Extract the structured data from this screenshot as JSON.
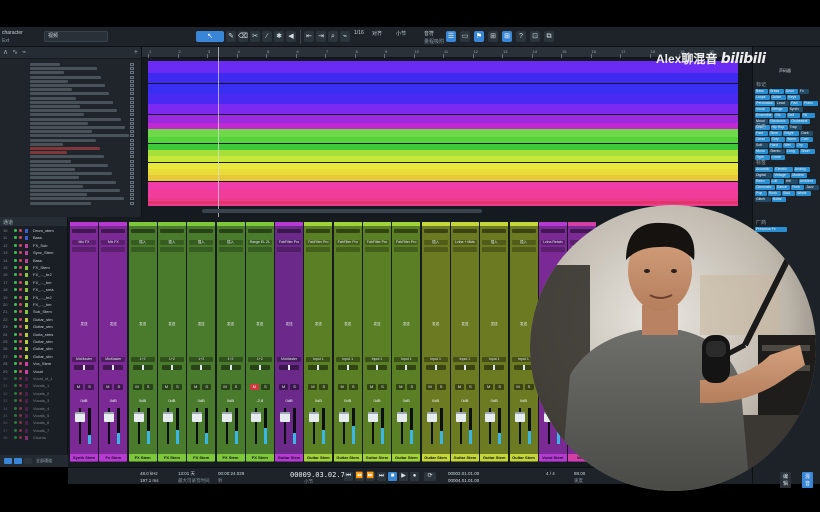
{
  "toolbar": {
    "project_label": "character",
    "project_sub": "Ext",
    "dropdown_label": "视频",
    "key_label": "1/16",
    "quantize_label": "对齐",
    "timebase_label": "小节",
    "snap_label": "音符",
    "snap_value": "量程吸附",
    "tools": [
      "↖",
      "✎",
      "⌫",
      "✂",
      "∕",
      "✱",
      "◀",
      "⌁"
    ],
    "right_buttons": [
      "☰",
      "▭",
      "⚑",
      "⊞",
      "?",
      "⊡",
      "⧉"
    ]
  },
  "watermark": {
    "name": "Alex聊混音",
    "brand": "bilibili",
    "sub": "声码器"
  },
  "ruler": {
    "marks": [
      "1",
      "2",
      "3",
      "4",
      "5",
      "6",
      "7",
      "8",
      "9",
      "10",
      "11",
      "12",
      "13",
      "14",
      "15",
      "16",
      "17",
      "18",
      "19",
      "20"
    ]
  },
  "tagpanel": {
    "heading_1": "标记",
    "tags_1": [
      "Bass",
      "Brass",
      "Drum",
      "Fx",
      "Loops",
      "Guitar",
      "Keys",
      "Percussion",
      "Lead",
      "Pad",
      "Piano",
      "Vocal",
      "Strings",
      "Synth",
      "Ensemble",
      "Sfx",
      "Bell",
      "Fill",
      "Mood",
      "Electronic",
      "Orchestral",
      "Chill",
      "Hip Hop",
      "Trap"
    ],
    "heading_2": "风格",
    "tags_2": [
      "Fast",
      "Slow",
      "Bright",
      "Dark",
      "Clean",
      "Dirty",
      "Warm",
      "Cold",
      "Soft",
      "Hard",
      "Wet",
      "Dry",
      "Mono",
      "Stereo",
      "Long",
      "Short",
      "Tight",
      "Loose"
    ],
    "heading_3": "标签",
    "tags_3": [
      "Acoustic",
      "Electric",
      "Analog",
      "Digital",
      "Vintage",
      "Modern",
      "Retro",
      "Lofi",
      "Hifi",
      "Ambient",
      "Cinematic",
      "Dance",
      "Funk",
      "Jazz",
      "Pop",
      "Rock",
      "Soul",
      "World",
      "Glitch",
      "Noise"
    ],
    "heading_4": "厂商",
    "tag_vendor": "Presonus Fx"
  },
  "console_list": {
    "header": "通道",
    "rows": [
      {
        "num": "10",
        "name": "Drum_stem",
        "color": "#3a5bd9"
      },
      {
        "num": "11",
        "name": "Bass",
        "color": "#3a5bd9"
      },
      {
        "num": "12",
        "name": "FX_Sub",
        "color": "#c1429c"
      },
      {
        "num": "13",
        "name": "Sync_Stem",
        "color": "#c1429c"
      },
      {
        "num": "14",
        "name": "Bass",
        "color": "#c1429c"
      },
      {
        "num": "15",
        "name": "FX_Stem",
        "color": "#8ac43f"
      },
      {
        "num": "16",
        "name": "FX_..._br2",
        "color": "#8ac43f"
      },
      {
        "num": "17",
        "name": "FX_..._bm",
        "color": "#8ac43f"
      },
      {
        "num": "18",
        "name": "FX_..._sma",
        "color": "#8ac43f"
      },
      {
        "num": "19",
        "name": "FX_..._br2",
        "color": "#8ac43f"
      },
      {
        "num": "20",
        "name": "FX_..._bm",
        "color": "#8ac43f"
      },
      {
        "num": "21",
        "name": "Sub_Stem",
        "color": "#8ac43f"
      },
      {
        "num": "22",
        "name": "Guitar_stm",
        "color": "#b9c93a"
      },
      {
        "num": "23",
        "name": "Guitar_stm",
        "color": "#b9c93a"
      },
      {
        "num": "24",
        "name": "Guita_stms",
        "color": "#b9c93a"
      },
      {
        "num": "25",
        "name": "Guitar_stm",
        "color": "#b9c93a"
      },
      {
        "num": "26",
        "name": "Guitar_stm",
        "color": "#b9c93a"
      },
      {
        "num": "27",
        "name": "Guitar_stm",
        "color": "#b9c93a"
      },
      {
        "num": "28",
        "name": "Vox_Stem",
        "color": "#d43fa4"
      },
      {
        "num": "29",
        "name": "Vocal",
        "color": "#d43fa4"
      },
      {
        "num": "30",
        "name": "Vocal_st_1",
        "color": "#7a1f6a"
      },
      {
        "num": "31",
        "name": "Vocals_1",
        "color": "#7a1f6a"
      },
      {
        "num": "32",
        "name": "Vocals_2",
        "color": "#7a1f6a"
      },
      {
        "num": "33",
        "name": "Vocals_3",
        "color": "#7a1f6a"
      },
      {
        "num": "34",
        "name": "Vocals_4",
        "color": "#7a1f6a"
      },
      {
        "num": "35",
        "name": "Vocals_5",
        "color": "#7a1f6a"
      },
      {
        "num": "36",
        "name": "Vocals_6",
        "color": "#7a1f6a"
      },
      {
        "num": "37",
        "name": "Vocals_7",
        "color": "#7a1f6a"
      },
      {
        "num": "38",
        "name": "Chorus",
        "color": "#d43fa4"
      }
    ],
    "footer": "全部通道"
  },
  "arrangement": {
    "clip_colors": [
      "#6a2bf5",
      "#3f2bf0",
      "#3a2ef2",
      "#4a2af2",
      "#7c2af0",
      "#9a2bdf",
      "#c12ad0",
      "#6fd94a",
      "#56d43c",
      "#3ec83a",
      "#a8e03a",
      "#c6e83a",
      "#e8e83a",
      "#e8dc3a",
      "#e8c83a",
      "#f03ca8",
      "#f23c9a",
      "#ef3a92"
    ]
  },
  "mixer": {
    "strips": [
      {
        "name": "Synth Stem",
        "color": "#7b2a95",
        "name_color": "#b63ad2",
        "insert": "Mix FX",
        "send": "发送",
        "route": "MixMaster",
        "vol": "0dB",
        "level": 0.25
      },
      {
        "name": "Fx Stem",
        "color": "#7b2a95",
        "name_color": "#b63ad2",
        "insert": "Mix FX",
        "send": "发送",
        "route": "MixMaster",
        "vol": "0dB",
        "level": 0.3
      },
      {
        "name": "FX Stem",
        "color": "#4a7b2c",
        "name_color": "#7ec73a",
        "insert": "插入",
        "send": "发送",
        "route": "1+2",
        "vol": "0dB",
        "level": 0.35
      },
      {
        "name": "FX Stem",
        "color": "#4a7b2c",
        "name_color": "#7ec73a",
        "insert": "插入",
        "send": "发送",
        "route": "1+2",
        "vol": "0dB",
        "level": 0.4
      },
      {
        "name": "FX Stem",
        "color": "#4a7b2c",
        "name_color": "#7ec73a",
        "insert": "插入",
        "send": "发送",
        "route": "1+2",
        "vol": "0dB",
        "level": 0.3
      },
      {
        "name": "FX Stem",
        "color": "#4a7b2c",
        "name_color": "#7ec73a",
        "insert": "插入",
        "send": "发送",
        "route": "1+2",
        "vol": "0dB",
        "level": 0.35
      },
      {
        "name": "FX Stem",
        "color": "#4a7b2c",
        "name_color": "#7ec73a",
        "insert": "Range EL 2L",
        "send": "发送",
        "route": "1+2",
        "vol": "-2.8",
        "level": 0.45
      },
      {
        "name": "Guitar Stem",
        "color": "#6b2a8a",
        "name_color": "#b63ad2",
        "insert": "FabFilter Pro",
        "send": "发送",
        "route": "MixMaster",
        "vol": "0dB",
        "level": 0.3
      },
      {
        "name": "Guitar Stem",
        "color": "#5a7f24",
        "name_color": "#a2d23a",
        "insert": "FabFilter Pro",
        "send": "发送",
        "route": "Input 1",
        "vol": "0dB",
        "level": 0.4
      },
      {
        "name": "Guitar Stem",
        "color": "#5a7f24",
        "name_color": "#a2d23a",
        "insert": "FabFilter Pro",
        "send": "发送",
        "route": "Input 1",
        "vol": "0dB",
        "level": 0.5
      },
      {
        "name": "Guitar Stem",
        "color": "#5a7f24",
        "name_color": "#a2d23a",
        "insert": "FabFilter Pro",
        "send": "发送",
        "route": "Input 1",
        "vol": "0dB",
        "level": 0.45
      },
      {
        "name": "Guitar Stem",
        "color": "#5a7f24",
        "name_color": "#a2d23a",
        "insert": "FabFilter Pro",
        "send": "发送",
        "route": "Input 1",
        "vol": "0dB",
        "level": 0.4
      },
      {
        "name": "Guitar Stem",
        "color": "#6c7a22",
        "name_color": "#c4d63a",
        "insert": "插入",
        "send": "发送",
        "route": "Input 1",
        "vol": "0dB",
        "level": 0.35
      },
      {
        "name": "Guitar Stem",
        "color": "#6c7a22",
        "name_color": "#c4d63a",
        "insert": "Lvlna + Mkts",
        "send": "发送",
        "route": "Input 1",
        "vol": "0dB",
        "level": 0.4
      },
      {
        "name": "Guitar Stem",
        "color": "#6c7a22",
        "name_color": "#c4d63a",
        "insert": "插入",
        "send": "发送",
        "route": "Input 1",
        "vol": "0dB",
        "level": 0.3
      },
      {
        "name": "Guitar Stem",
        "color": "#6c7a22",
        "name_color": "#c4d63a",
        "insert": "插入",
        "send": "发送",
        "route": "Input 1",
        "vol": "0dB",
        "level": 0.35
      },
      {
        "name": "Vocal Stem",
        "color": "#7b2a95",
        "name_color": "#b63ad2",
        "insert": "Lvlna Retain",
        "send": "发送",
        "route": "MixMaster",
        "vol": "0dB",
        "level": 0.5
      },
      {
        "name": "Vocal",
        "color": "#7b2a95",
        "name_color": "#d43fa4",
        "insert": "插入",
        "send": "发送",
        "route": "MixMaster",
        "vol": "0dB",
        "level": 0.4
      }
    ]
  },
  "transport": {
    "sample_rate": "48.0 kHz",
    "cpu": "197.1 ms",
    "record_time": "13:01 天",
    "record_label": "最大可录音时间",
    "time_secs": "00:00:24.029",
    "time_label": "秒",
    "bars": "00009.03.02.76",
    "bars_label": "小节",
    "loop_start": "00002.01.01.00",
    "loop_end": "00004.01.01.00",
    "signature": "4 / 4",
    "tempo": "88.00",
    "tempo_label": "速度",
    "metronome_label": "节拍器",
    "buttons": [
      "⏮",
      "⏪",
      "⏩",
      "⏭",
      "■",
      "▶",
      "●",
      "⟳"
    ]
  },
  "bottom_right": {
    "btn_1": "编辑",
    "btn_2": "混音"
  }
}
